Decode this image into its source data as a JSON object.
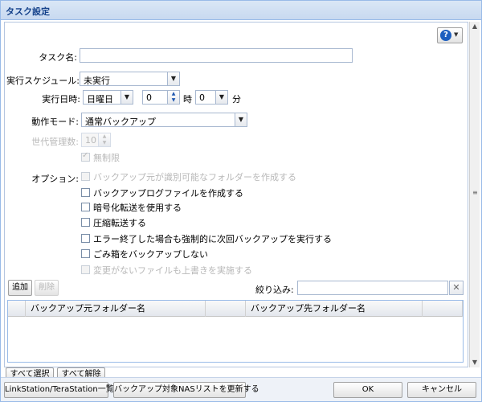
{
  "window": {
    "title": "タスク設定"
  },
  "help": {
    "icon": "question-icon"
  },
  "task_name": {
    "label": "タスク名:",
    "value": ""
  },
  "schedule": {
    "label": "実行スケジュール:",
    "value": "未実行"
  },
  "run_time": {
    "label": "実行日時:",
    "day": "日曜日",
    "hour": "0",
    "hour_unit": "時",
    "minute": "0",
    "minute_unit": "分"
  },
  "mode": {
    "label": "動作モード:",
    "value": "通常バックアップ"
  },
  "generations": {
    "label": "世代管理数:",
    "value": "10",
    "unlimited_label": "無制限",
    "unlimited_checked": true
  },
  "options": {
    "label": "オプション:",
    "items": [
      {
        "label": "バックアップ元が識別可能なフォルダーを作成する",
        "checked": false,
        "disabled": true
      },
      {
        "label": "バックアップログファイルを作成する",
        "checked": false,
        "disabled": false
      },
      {
        "label": "暗号化転送を使用する",
        "checked": false,
        "disabled": false
      },
      {
        "label": "圧縮転送する",
        "checked": false,
        "disabled": false
      },
      {
        "label": "エラー終了した場合も強制的に次回バックアップを実行する",
        "checked": false,
        "disabled": false
      },
      {
        "label": "ごみ箱をバックアップしない",
        "checked": false,
        "disabled": false
      },
      {
        "label": "変更がないファイルも上書きを実施する",
        "checked": false,
        "disabled": true
      }
    ]
  },
  "grid_toolbar": {
    "add": "追加",
    "delete": "削除",
    "filter_label": "絞り込み:",
    "filter_value": ""
  },
  "grid": {
    "columns": [
      "バックアップ元フォルダー名",
      "バックアップ先フォルダー名"
    ],
    "rows": []
  },
  "selection": {
    "select_all": "すべて選択",
    "deselect_all": "すべて解除"
  },
  "footer": {
    "linkstation_list": "LinkStation/TeraStation一覧",
    "refresh_nas": "バックアップ対象NASリストを更新する",
    "ok": "OK",
    "cancel": "キャンセル"
  }
}
